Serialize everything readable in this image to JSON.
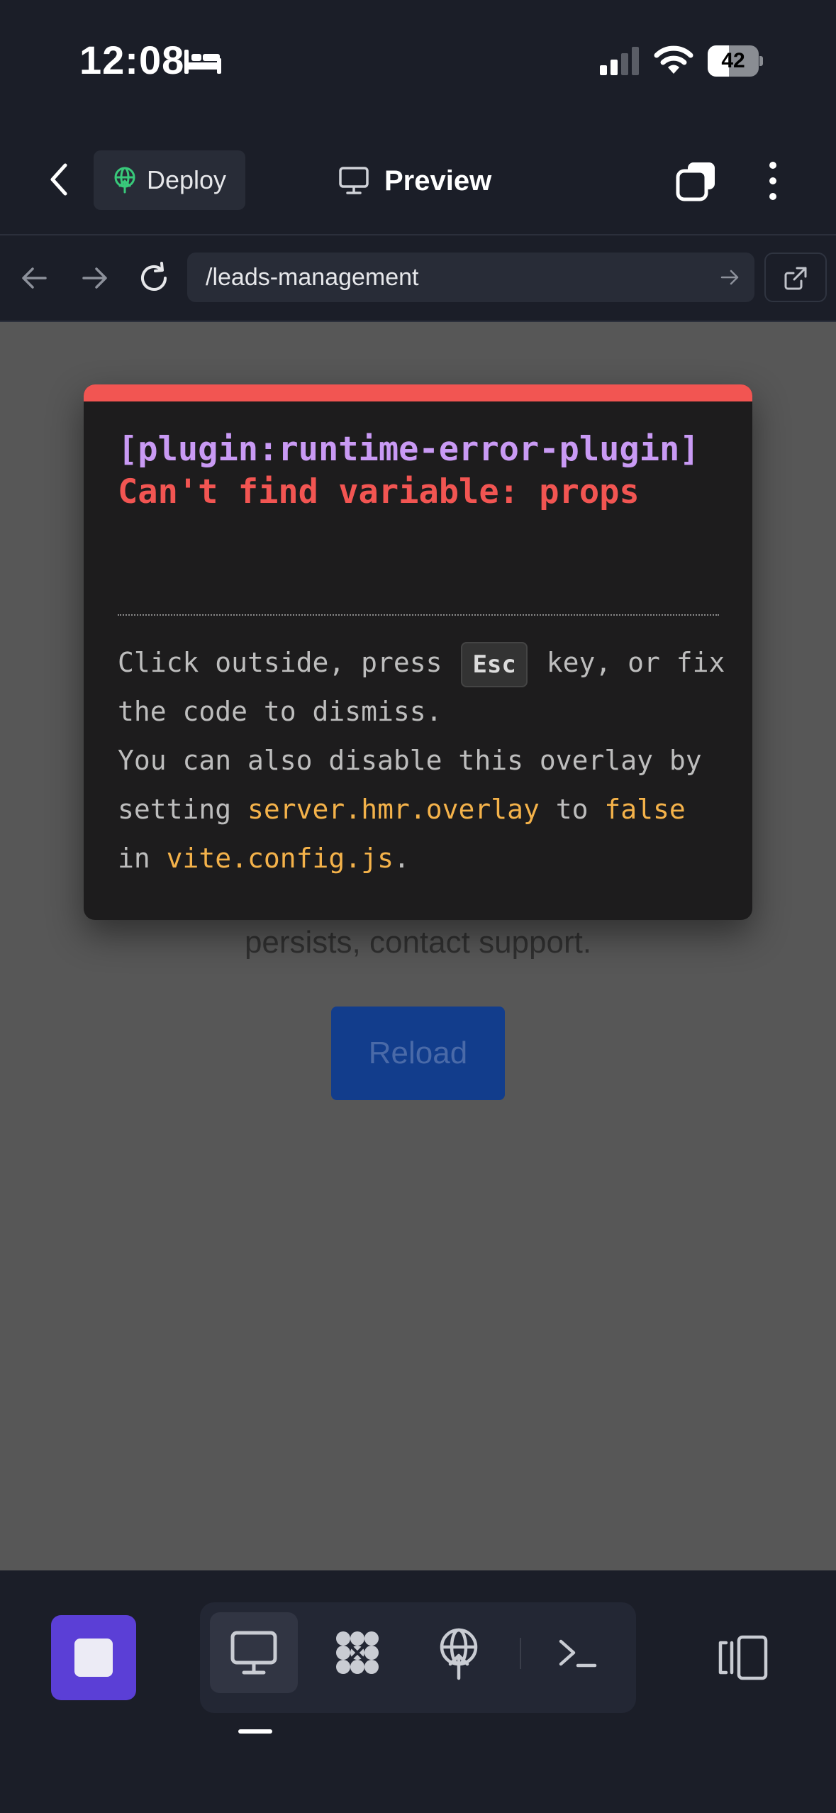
{
  "status_bar": {
    "time": "12:08",
    "battery": "42",
    "battery_level": 0.42
  },
  "header": {
    "deploy_label": "Deploy",
    "preview_label": "Preview"
  },
  "url_bar": {
    "path": "/leads-management"
  },
  "page_background": {
    "message": "persists, contact support.",
    "reload_label": "Reload"
  },
  "error_overlay": {
    "plugin": "[plugin:runtime-error-plugin]",
    "message": "Can't find variable: props",
    "tip_1": "Click outside, press",
    "tip_key": "Esc",
    "tip_2": "key, or fix the code to dismiss.",
    "tip_3": "You can also disable this overlay by setting",
    "tip_code_1": "server.hmr.overlay",
    "tip_4": "to",
    "tip_code_2": "false",
    "tip_5": "in",
    "tip_code_3": "vite.config.js",
    "tip_6": "."
  },
  "colors": {
    "background": "#1b1e28",
    "accent": "#5b3fd6",
    "error_red": "#f25552",
    "plugin_purple": "#c99af4",
    "code_orange": "#f4b24a"
  },
  "icons": {
    "back": "chevron-left-icon",
    "deploy": "deploy-globe-icon",
    "preview": "monitor-icon",
    "tabs": "tabs-icon",
    "more": "more-vertical-icon",
    "bottom_tools": [
      "monitor-icon",
      "packages-icon",
      "deploy-icon",
      "terminal-icon"
    ],
    "panel": "panel-toggle-icon"
  }
}
